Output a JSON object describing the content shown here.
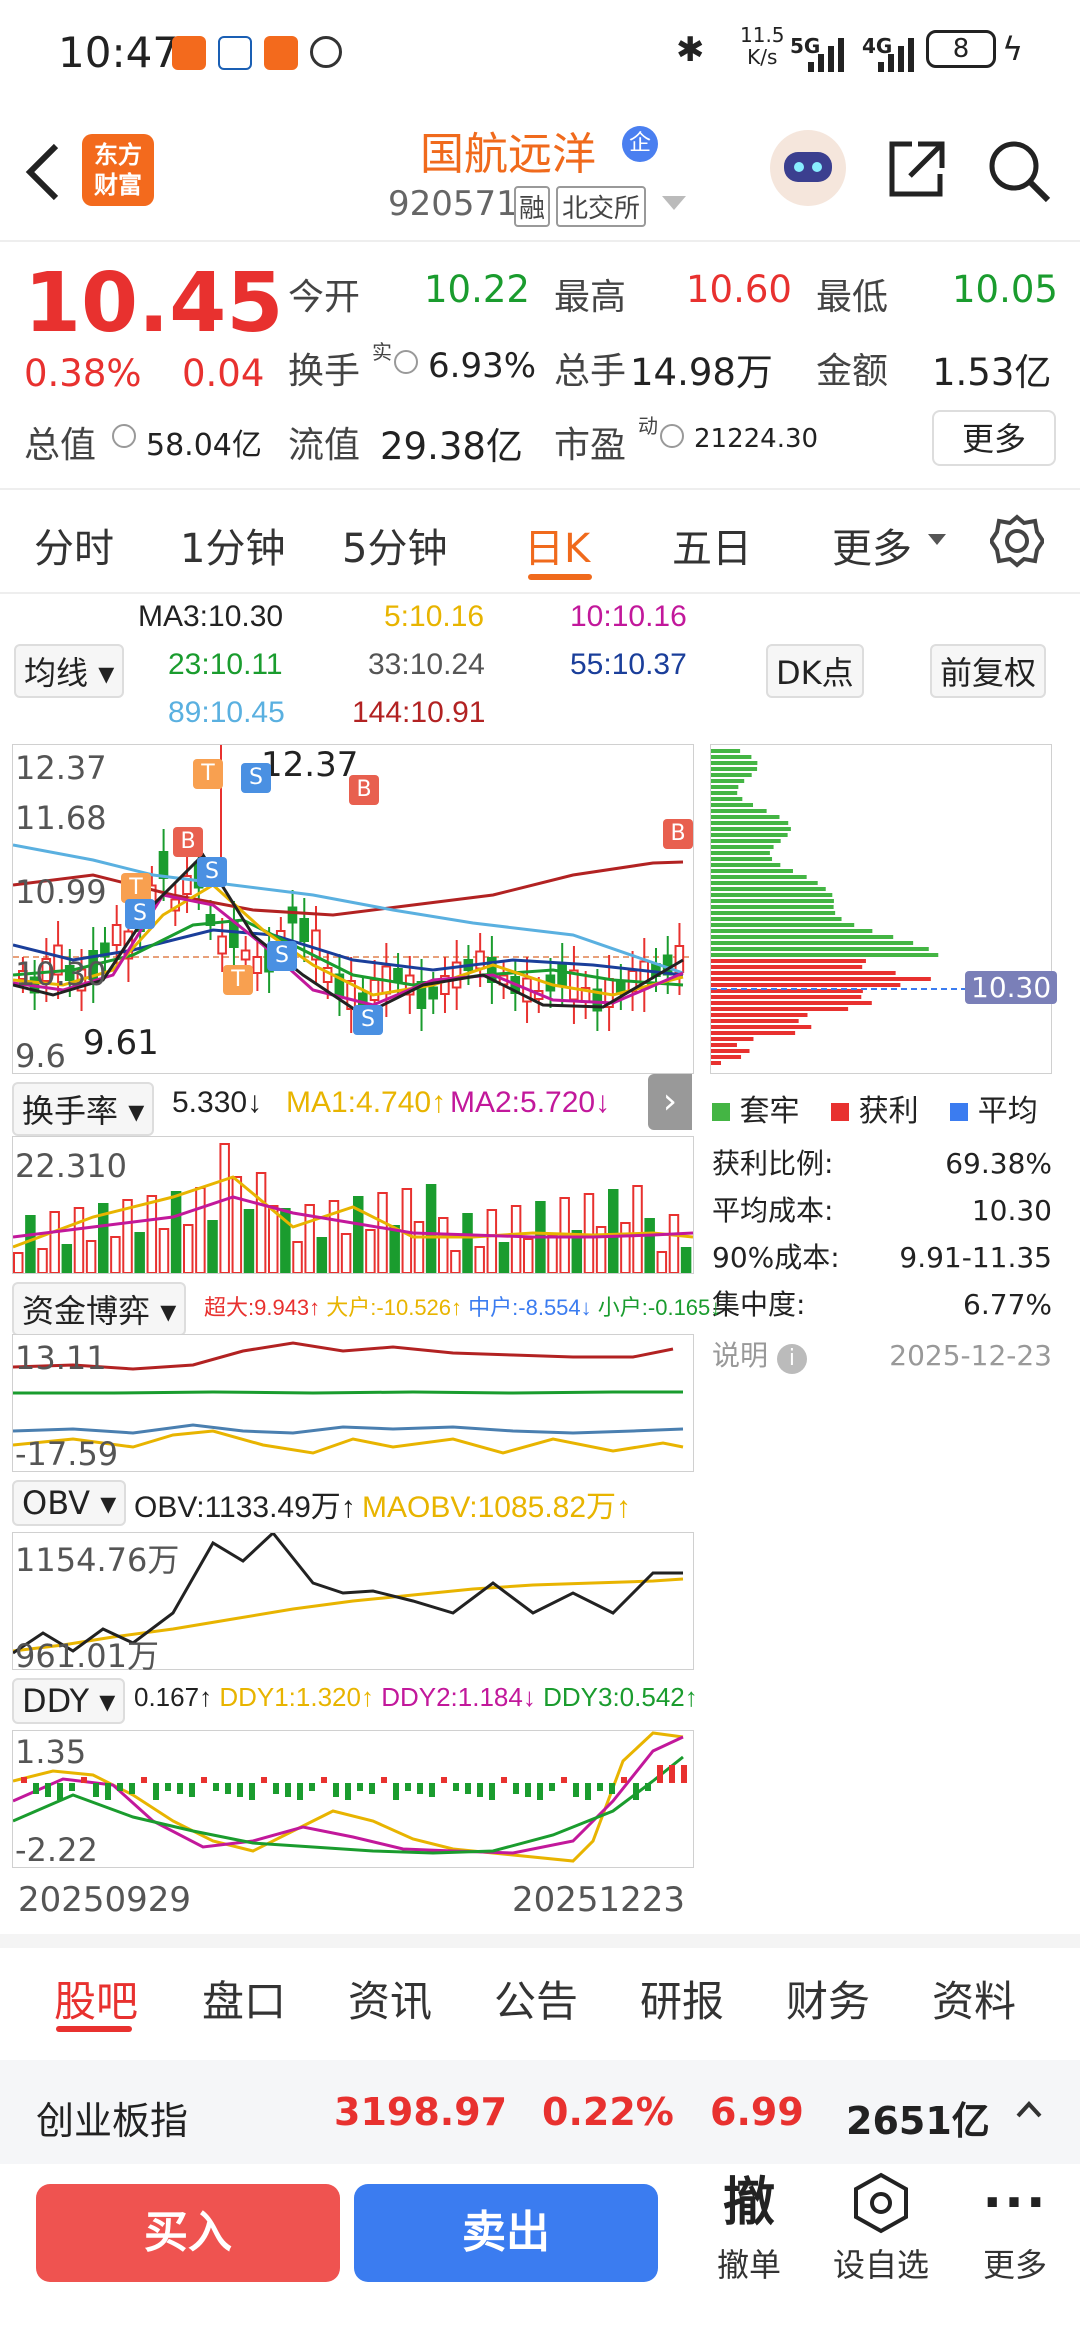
{
  "status_bar": {
    "time": "10:47",
    "net_speed_top": "11.5",
    "net_speed_bottom": "K/s",
    "signal1": "5G",
    "signal2": "4G",
    "battery": "8"
  },
  "header": {
    "back_icon": "back-arrow-icon",
    "logo_line1": "东方",
    "logo_line2": "财富",
    "stock_name": "国航远洋",
    "badge": "企",
    "stock_code": "920571",
    "tag_margin": "融",
    "tag_exchange": "北交所"
  },
  "quote": {
    "price": "10.45",
    "change_pct": "0.38%",
    "change_amt": "0.04",
    "open_label": "今开",
    "open": "10.22",
    "high_label": "最高",
    "high": "10.60",
    "low_label": "最低",
    "low": "10.05",
    "turnover_label": "换手",
    "turnover_sup": "实",
    "turnover": "6.93%",
    "volume_label": "总手",
    "volume": "14.98万",
    "amount_label": "金额",
    "amount": "1.53亿",
    "total_cap_label": "总值",
    "total_cap": "58.04亿",
    "float_cap_label": "流值",
    "float_cap": "29.38亿",
    "pe_label": "市盈",
    "pe_sup": "动",
    "pe": "21224.30",
    "more_label": "更多"
  },
  "period_tabs": [
    "分时",
    "1分钟",
    "5分钟",
    "日K",
    "五日",
    "更多"
  ],
  "period_active": 3,
  "ma": {
    "selector": "均线",
    "ma3": "MA3:10.30",
    "ma5": "5:10.16",
    "ma10": "10:10.16",
    "ma23": "23:10.11",
    "ma33": "33:10.24",
    "ma55": "55:10.37",
    "ma89": "89:10.45",
    "ma144": "144:10.91",
    "dk_label": "DK点",
    "adjust_label": "前复权"
  },
  "kline": {
    "y_labels": [
      "12.37",
      "11.68",
      "10.99",
      "10.30",
      "9.6"
    ],
    "high_marker": "12.37",
    "low_marker": "9.61"
  },
  "chips": {
    "price_line": "10.30",
    "legend": [
      "套牢",
      "获利",
      "平均"
    ],
    "rows": [
      {
        "label": "获利比例:",
        "value": "69.38%"
      },
      {
        "label": "平均成本:",
        "value": "10.30"
      },
      {
        "label": "90%成本:",
        "value": "9.91-11.35"
      },
      {
        "label": "集中度:",
        "value": "6.77%"
      }
    ],
    "note_label": "说明",
    "date": "2025-12-23"
  },
  "turnover_panel": {
    "selector": "换手率",
    "value": "5.330",
    "ma1": "MA1:4.740",
    "ma2": "MA2:5.720",
    "y_label": "22.310"
  },
  "capital_panel": {
    "selector": "资金博弈",
    "super": "超大:9.943",
    "big": "大户:-10.526",
    "mid": "中户:-8.554",
    "small": "小户:-0.165",
    "y_top": "13.11",
    "y_bottom": "-17.59"
  },
  "obv_panel": {
    "selector": "OBV",
    "obv": "OBV:1133.49万",
    "maobv": "MAOBV:1085.82万",
    "y_top": "1154.76万",
    "y_bottom": "961.01万"
  },
  "ddy_panel": {
    "selector": "DDY",
    "ddy": "0.167",
    "ddy1": "DDY1:1.320",
    "ddy2": "DDY2:1.184",
    "ddy3": "DDY3:0.542",
    "y_top": "1.35",
    "y_bottom": "-2.22"
  },
  "date_axis": {
    "start": "20250929",
    "end": "20251223"
  },
  "bottom_tabs": [
    "股吧",
    "盘口",
    "资讯",
    "公告",
    "研报",
    "财务",
    "资料"
  ],
  "bottom_active": 0,
  "index_bar": {
    "name": "创业板指",
    "value": "3198.97",
    "pct": "0.22%",
    "change": "6.99",
    "amount": "2651亿"
  },
  "actions": {
    "buy": "买入",
    "sell": "卖出",
    "cancel_icon_text": "撤",
    "cancel": "撤单",
    "watch": "设自选",
    "more": "更多"
  },
  "colors": {
    "up": "#e8312f",
    "down": "#1a9c2e",
    "accent": "#f06a1c",
    "sell_blue": "#3b7cf0"
  }
}
